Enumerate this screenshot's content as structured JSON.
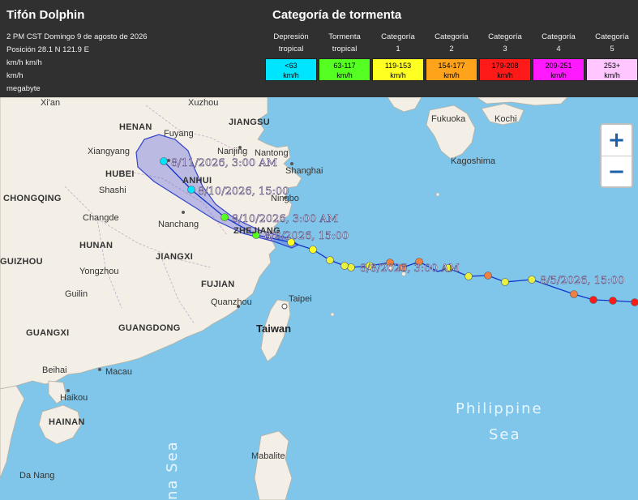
{
  "storm": {
    "title": "Tifón Dolphin",
    "datetime": "2 PM CST Domingo 9 de agosto de 2026",
    "position": "Posición 28.1 N 121.9 E",
    "line3": "km/h km/h",
    "line4": "km/h",
    "line5": "megabyte"
  },
  "legend": {
    "title": "Categoría de tormenta",
    "categories": [
      {
        "label1": "Depresión",
        "label2": "tropical",
        "range": "<63",
        "unit": "km/h",
        "color": "#00e5ff"
      },
      {
        "label1": "Tormenta",
        "label2": "tropical",
        "range": "63-117",
        "unit": "km/h",
        "color": "#55ff22"
      },
      {
        "label1": "Categoría",
        "label2": "1",
        "range": "119-153",
        "unit": "km/h",
        "color": "#ffff22"
      },
      {
        "label1": "Categoría",
        "label2": "2",
        "range": "154-177",
        "unit": "km/h",
        "color": "#ffa31a"
      },
      {
        "label1": "Categoría",
        "label2": "3",
        "range": "179-208",
        "unit": "km/h",
        "color": "#ff1a1a"
      },
      {
        "label1": "Categoría",
        "label2": "4",
        "range": "209-251",
        "unit": "km/h",
        "color": "#ff1aff"
      },
      {
        "label1": "Categoría",
        "label2": "5",
        "range": "253+",
        "unit": "km/h",
        "color": "#ffc6ff"
      }
    ]
  },
  "map": {
    "places": {
      "xian": "Xi'an",
      "xuzhou": "Xuzhou",
      "henan": "HENAN",
      "jiangsu": "JIANGSU",
      "fuyang": "Fuyang",
      "xiangyang": "Xiangyang",
      "hubei": "HUBEI",
      "nanjing": "Nanjing",
      "nantong": "Nantong",
      "shanghai": "Shanghai",
      "anhui": "ANHUI",
      "shashi": "Shashi",
      "chongqing": "CHONGQING",
      "ningbo": "Ningbo",
      "changde": "Changde",
      "nanchang": "Nanchang",
      "zhejiang": "ZHEJIANG",
      "jiangxi": "JIANGXI",
      "guizhou": "GUIZHOU",
      "hunan": "HUNAN",
      "yongzhou": "Yongzhou",
      "fujian": "FUJIAN",
      "taipei": "Taipei",
      "guilin": "Guilin",
      "quanzhou": "Quanzhou",
      "guangxi": "GUANGXI",
      "guangdong": "GUANGDONG",
      "taiwan": "Taiwan",
      "beihai": "Beihai",
      "macau": "Macau",
      "haikou": "Haikou",
      "hainan": "HAINAN",
      "danang": "Da Nang",
      "mabalite": "Mabalite",
      "fukuoka": "Fukuoka",
      "kochi": "Kochi",
      "kagoshima": "Kagoshima",
      "philippine": "Philippine",
      "sea": "Sea",
      "china_sea": "na Sea"
    },
    "track_labels": {
      "aug11": "8/11/2026, 3:00 AM",
      "aug10pm": "8/10/2026, 15:00",
      "aug10am": "8/10/2026, 3:00 AM",
      "aug9pm": "8/9/2026, 15:00",
      "aug8am": "8/8/2026, 3:00 AM",
      "aug5pm": "8/5/2026, 15:00"
    }
  },
  "zoom": {
    "in": "+",
    "out": "−"
  }
}
